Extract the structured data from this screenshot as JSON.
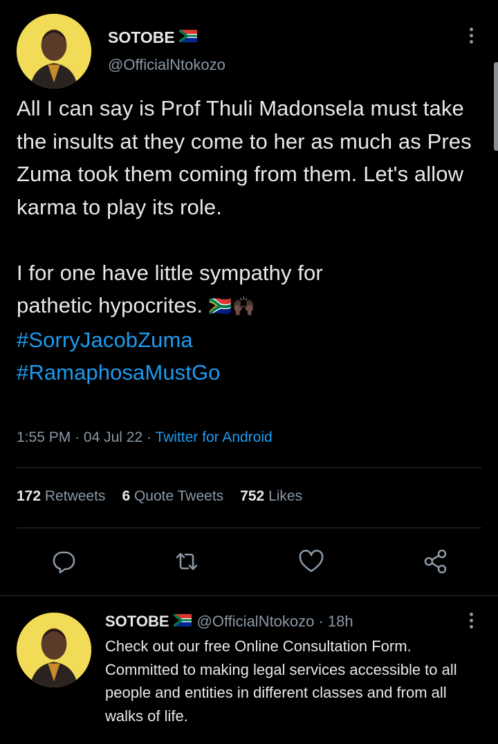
{
  "tweet": {
    "author_name": "SOTOBE",
    "author_handle": "@OfficialNtokozo",
    "text_paragraphs": [
      "All I can say is Prof Thuli Madonsela must take the insults at they come to her as much as Pres Zuma took them coming from them. Let's allow karma to play its role.",
      "I for one have little sympathy for pathetic hypocrites."
    ],
    "emoji_after_text": "🇿🇦🙌🏿",
    "hashtags": [
      "#SorryJacobZuma",
      "#RamaphosaMustGo"
    ],
    "time": "1:55 PM",
    "date": "04 Jul 22",
    "source": "Twitter for Android",
    "separator": "·"
  },
  "stats": {
    "retweets_count": "172",
    "retweets_label": "Retweets",
    "quotes_count": "6",
    "quotes_label": "Quote Tweets",
    "likes_count": "752",
    "likes_label": "Likes"
  },
  "actions": [
    "reply-icon",
    "retweet-icon",
    "like-icon",
    "share-icon"
  ],
  "reply_tweet": {
    "author_name": "SOTOBE",
    "author_handle": "@OfficialNtokozo",
    "age": "· 18h",
    "text": "Check out our free Online Consultation Form. Committed to making legal services accessible to all people and entities in different classes and from all walks of life."
  },
  "colors": {
    "background": "#000000",
    "text": "#e7e9ea",
    "secondary": "#8b98a5",
    "accent": "#1d9bf0",
    "divider": "#2f3336"
  }
}
